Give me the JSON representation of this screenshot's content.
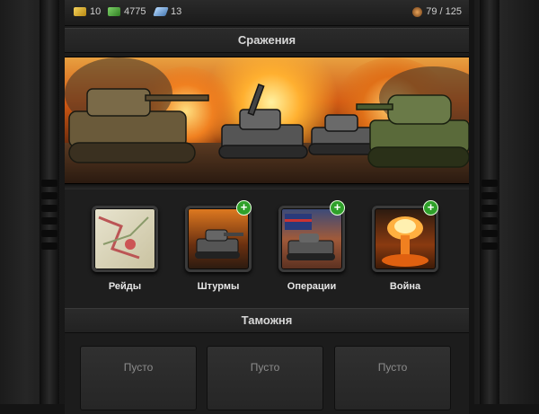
{
  "resources": {
    "gold": "10",
    "cash": "4775",
    "fuel": "13",
    "capacity": "79 / 125"
  },
  "section_battles": {
    "title": "Сражения"
  },
  "battles": [
    {
      "label": "Рейды",
      "has_plus": false
    },
    {
      "label": "Штурмы",
      "has_plus": true
    },
    {
      "label": "Операции",
      "has_plus": true
    },
    {
      "label": "Война",
      "has_plus": true
    }
  ],
  "section_customs": {
    "title": "Таможня"
  },
  "customs_slots": [
    "Пусто",
    "Пусто",
    "Пусто"
  ],
  "plus_symbol": "+",
  "colors": {
    "accent_plus": "#2fa02a",
    "header_text": "#d7d7d7"
  }
}
